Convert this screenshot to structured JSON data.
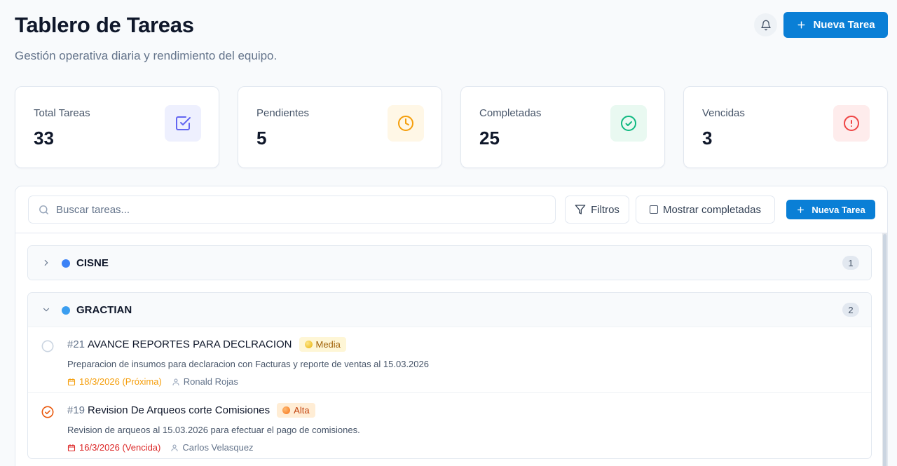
{
  "header": {
    "title": "Tablero de Tareas",
    "subtitle": "Gestión operativa diaria y rendimiento del equipo.",
    "new_task_label": "Nueva Tarea"
  },
  "stats": [
    {
      "label": "Total Tareas",
      "value": "33",
      "icon": "checkbox-icon",
      "color": "#6366f1",
      "bg": "#eef0fe"
    },
    {
      "label": "Pendientes",
      "value": "5",
      "icon": "clock-icon",
      "color": "#f59e0b",
      "bg": "#fff7e6"
    },
    {
      "label": "Completadas",
      "value": "25",
      "icon": "check-circle-icon",
      "color": "#10b981",
      "bg": "#e9f9f1"
    },
    {
      "label": "Vencidas",
      "value": "3",
      "icon": "alert-circle-icon",
      "color": "#ef4444",
      "bg": "#feecec"
    }
  ],
  "toolbar": {
    "search_placeholder": "Buscar tareas...",
    "filters_label": "Filtros",
    "show_completed_label": "Mostrar completadas",
    "new_task_label": "Nueva Tarea"
  },
  "groups": [
    {
      "name": "CISNE",
      "count": "1",
      "expanded": false,
      "color": "#3b82f6"
    },
    {
      "name": "GRACTIAN",
      "count": "2",
      "expanded": true,
      "color": "#3b9ef0",
      "tasks": [
        {
          "id": "#21",
          "title": "AVANCE REPORTES PARA DECLRACION",
          "priority": "Media",
          "priority_color": "#eab308",
          "priority_bg": "#fef6d6",
          "priority_text": "#a16207",
          "description": "Preparacion de insumos para declaracion con Facturas y reporte de ventas al 15.03.2026",
          "date": "18/3/2026 (Próxima)",
          "date_color": "#f59e0b",
          "assignee": "Ronald Rojas",
          "status": "pending"
        },
        {
          "id": "#19",
          "title": "Revision De Arqueos corte Comisiones",
          "priority": "Alta",
          "priority_color": "#f97316",
          "priority_bg": "#ffedd5",
          "priority_text": "#c2410c",
          "description": "Revision de arqueos al 15.03.2026 para efectuar el pago de comisiones.",
          "date": "16/3/2026 (Vencida)",
          "date_color": "#dc2626",
          "assignee": "Carlos Velasquez",
          "status": "in-progress"
        }
      ]
    }
  ],
  "colors": {
    "accent": "#0a7fd6"
  }
}
